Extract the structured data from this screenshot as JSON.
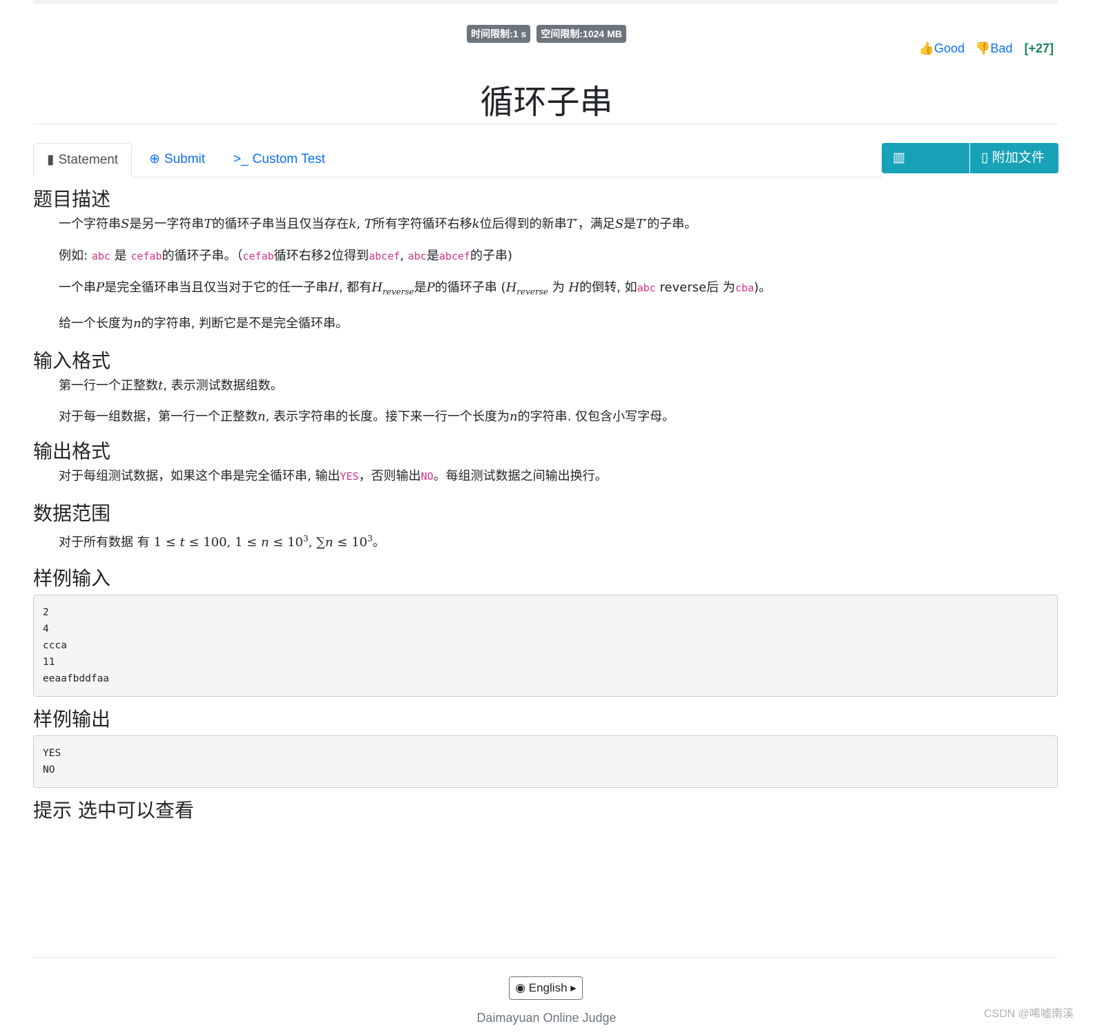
{
  "limits": {
    "time": "时间限制:1 s",
    "memory": "空间限制:1024 MB"
  },
  "vote": {
    "good": "Good",
    "bad": "Bad",
    "score": "[+27]"
  },
  "title": "循环子串",
  "tabs": [
    {
      "label": "Statement",
      "icon": "book-icon"
    },
    {
      "label": "Submit",
      "icon": "upload-circle-icon"
    },
    {
      "label": "Custom Test",
      "icon": "terminal-icon"
    }
  ],
  "buttons": {
    "statistics": "Statistics",
    "attachments": "附加文件"
  },
  "sections": {
    "description": {
      "heading": "题目描述",
      "p1": {
        "a": "一个字符串",
        "S": "S",
        "b": "是另一字符串",
        "T": "T",
        "c": "的循环子串当且仅当存在",
        "k": "k",
        "d": ", ",
        "T2": "T",
        "e": "所有字符循环右移",
        "k2": "k",
        "f": "位后得到的新串",
        "Tp": "T′",
        "g": "，满足",
        "S2": "S",
        "h": "是",
        "Tp2": "T′",
        "i": "的子串。"
      },
      "p2": {
        "a": "例如: ",
        "abc": "abc",
        "b": " 是 ",
        "cefab": "cefab",
        "c": "的循环子串。（",
        "cefab2": "cefab",
        "d": "循环右移2位得到",
        "abcef": "abcef",
        "e": ", ",
        "abc2": "abc",
        "f": "是",
        "abcef2": "abcef",
        "g": "的子串)"
      },
      "p3": {
        "a": "一个串",
        "P": "P",
        "b": "是完全循环串当且仅当对于它的任一子串",
        "H": "H",
        "c": ", 都有",
        "Hr": "H",
        "rev": "reverse",
        "d": "是",
        "P2": "P",
        "e": "的循环子串 (",
        "Hr2": "H",
        "rev2": "reverse",
        "f": " 为 ",
        "H3": "H",
        "g": "的倒转, 如",
        "abc": "abc",
        "h": " reverse后 为",
        "cba": "cba",
        "i": ")。"
      },
      "p4": {
        "a": "给一个长度为",
        "n": "n",
        "b": "的字符串, 判断它是不是完全循环串。"
      }
    },
    "input": {
      "heading": "输入格式",
      "p1": {
        "a": "第一行一个正整数",
        "t": "t",
        "b": ", 表示测试数据组数。"
      },
      "p2": {
        "a": "对于每一组数据，第一行一个正整数",
        "n": "n",
        "b": ", 表示字符串的长度。接下来一行一个长度为",
        "n2": "n",
        "c": "的字符串. 仅包含小写字母。"
      }
    },
    "output": {
      "heading": "输出格式",
      "p1": {
        "a": "对于每组测试数据，如果这个串是完全循环串, 输出",
        "yes": "YES",
        "b": "，否则输出",
        "no": "NO",
        "c": "。每组测试数据之间输出换行。"
      }
    },
    "range": {
      "heading": "数据范围",
      "p1": {
        "a": "对于所有数据 有 ",
        "m1": "1 ≤ ",
        "t": "t",
        "m2": " ≤ 100, 1 ≤ ",
        "n": "n",
        "m3": " ≤ 10",
        "e1": "3",
        "m4": ", ∑",
        "n2": "n",
        "m5": " ≤ 10",
        "e2": "3",
        "b": "。"
      }
    },
    "sample_input": {
      "heading": "样例输入",
      "content": "2\n4\nccca\n11\neeaafbddfaa"
    },
    "sample_output": {
      "heading": "样例输出",
      "content": "YES\nNO"
    },
    "hint": {
      "heading": "提示 选中可以查看"
    }
  },
  "footer": {
    "language": "English",
    "site": "Daimayuan Online Judge",
    "watermark": "CSDN @唏嘘南溪"
  }
}
